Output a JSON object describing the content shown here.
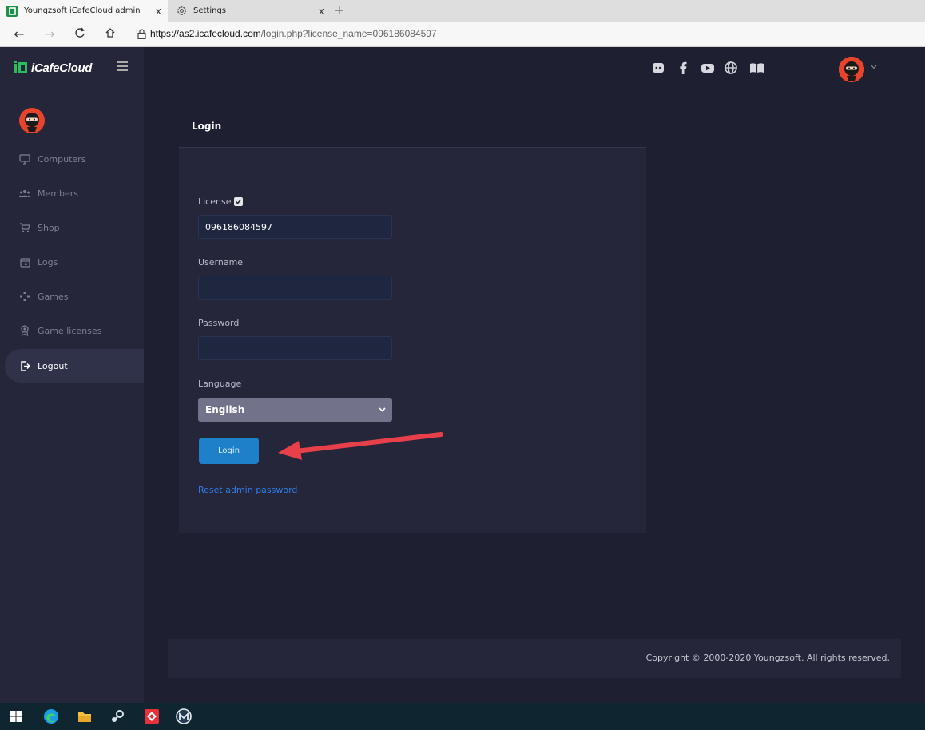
{
  "browser": {
    "tabs": [
      {
        "title": "Youngzsoft iCafeCloud admin",
        "close": "x"
      },
      {
        "title": "Settings",
        "close": "x"
      }
    ],
    "new_tab": "+",
    "url_host": "https://as2.icafecloud.com",
    "url_rest": "/login.php?license_name=096186084597"
  },
  "header": {
    "logo_text": "iCafeCloud",
    "social_icons": [
      "discord-icon",
      "facebook-icon",
      "youtube-icon",
      "globe-icon",
      "book-icon"
    ]
  },
  "sidebar": {
    "items": [
      {
        "label": "Computers",
        "icon": "monitor-icon"
      },
      {
        "label": "Members",
        "icon": "users-icon"
      },
      {
        "label": "Shop",
        "icon": "cart-icon"
      },
      {
        "label": "Logs",
        "icon": "calendar-icon"
      },
      {
        "label": "Games",
        "icon": "gamepad-icon"
      },
      {
        "label": "Game licenses",
        "icon": "award-icon"
      },
      {
        "label": "Logout",
        "icon": "logout-icon"
      }
    ]
  },
  "login": {
    "title": "Login",
    "license_label": "License",
    "license_value": "096186084597",
    "username_label": "Username",
    "username_value": "",
    "password_label": "Password",
    "password_value": "",
    "language_label": "Language",
    "language_selected": "English",
    "login_button": "Login",
    "reset_link": "Reset admin password"
  },
  "footer": {
    "copyright": "Copyright © 2000-2020 Youngzsoft. All rights reserved."
  },
  "colors": {
    "accent": "#1e80c8",
    "link": "#2f7ee8",
    "background": "#1e1f30",
    "panel": "#25263a",
    "avatar": "#e8442b",
    "annotation_arrow": "#e8404a"
  }
}
